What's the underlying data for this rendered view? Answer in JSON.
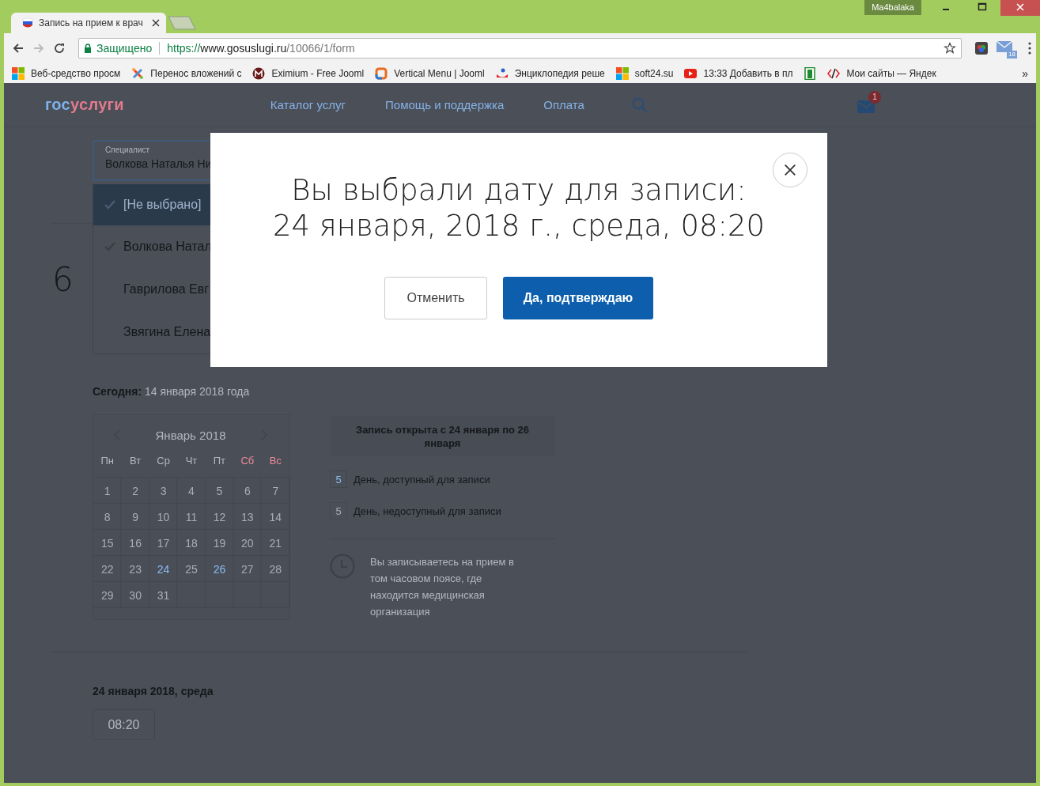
{
  "browser": {
    "profile": "Ma4balaka",
    "tabs": [
      {
        "title": "Запись на прием к врач",
        "selected": true
      }
    ],
    "address": {
      "security": "Защищено",
      "scheme": "https://",
      "host": "www.gosuslugi.ru",
      "path": "/10066/1/form"
    },
    "mail_badge": "18",
    "bookmarks": [
      {
        "kind": "windows",
        "label": "Веб-средство просм"
      },
      {
        "kind": "joomla",
        "label": "Перенос вложений с"
      },
      {
        "kind": "eximium",
        "label": "Eximium - Free Jooml"
      },
      {
        "kind": "ring",
        "label": "Vertical Menu | Jooml"
      },
      {
        "kind": "people",
        "label": "Энциклопедия реше"
      },
      {
        "kind": "windows",
        "label": "soft24.su"
      },
      {
        "kind": "youtube",
        "label": "13:33 Добавить в пл"
      },
      {
        "kind": "door"
      },
      {
        "kind": "code",
        "label": "Мои сайты — Яндек"
      }
    ],
    "more": "»"
  },
  "site": {
    "logo": {
      "first": "гос",
      "second": "услуги"
    },
    "nav": [
      "Каталог услуг",
      "Помощь и поддержка",
      "Оплата"
    ],
    "mail_badge": "1"
  },
  "specialist": {
    "label": "Специалист",
    "value": "Волкова Наталья Ни",
    "options": [
      {
        "label": "[Не выбрано]",
        "selected": true,
        "checked": true
      },
      {
        "label": "Волкова Натал",
        "selected": false,
        "checked": true
      },
      {
        "label": "Гаврилова Евг",
        "selected": false,
        "checked": false
      },
      {
        "label": "Звягина Елена",
        "selected": false,
        "checked": false
      }
    ]
  },
  "step": "6",
  "today": {
    "label": "Сегодня:",
    "value": "14 января 2018 года"
  },
  "calendar": {
    "month": "Январь 2018",
    "weekdays": [
      {
        "label": "Пн",
        "weekend": false
      },
      {
        "label": "Вт",
        "weekend": false
      },
      {
        "label": "Ср",
        "weekend": false
      },
      {
        "label": "Чт",
        "weekend": false
      },
      {
        "label": "Пт",
        "weekend": false
      },
      {
        "label": "Сб",
        "weekend": true
      },
      {
        "label": "Вс",
        "weekend": true
      }
    ],
    "days": [
      {
        "label": "1",
        "available": false
      },
      {
        "label": "2",
        "available": false
      },
      {
        "label": "3",
        "available": false
      },
      {
        "label": "4",
        "available": false
      },
      {
        "label": "5",
        "available": false
      },
      {
        "label": "6",
        "available": false
      },
      {
        "label": "7",
        "available": false
      },
      {
        "label": "8",
        "available": false
      },
      {
        "label": "9",
        "available": false
      },
      {
        "label": "10",
        "available": false
      },
      {
        "label": "11",
        "available": false
      },
      {
        "label": "12",
        "available": false
      },
      {
        "label": "13",
        "available": false
      },
      {
        "label": "14",
        "available": false
      },
      {
        "label": "15",
        "available": false
      },
      {
        "label": "16",
        "available": false
      },
      {
        "label": "17",
        "available": false
      },
      {
        "label": "18",
        "available": false
      },
      {
        "label": "19",
        "available": false
      },
      {
        "label": "20",
        "available": false
      },
      {
        "label": "21",
        "available": false
      },
      {
        "label": "22",
        "available": false
      },
      {
        "label": "23",
        "available": false
      },
      {
        "label": "24",
        "available": true
      },
      {
        "label": "25",
        "available": false
      },
      {
        "label": "26",
        "available": true
      },
      {
        "label": "27",
        "available": false
      },
      {
        "label": "28",
        "available": false
      },
      {
        "label": "29",
        "available": false
      },
      {
        "label": "30",
        "available": false
      },
      {
        "label": "31",
        "available": false
      }
    ]
  },
  "info": {
    "period": "Запись открыта с 24 января по 26 января",
    "legend": [
      {
        "sample": "5",
        "label": "День, доступный для записи",
        "available": true
      },
      {
        "sample": "5",
        "label": "День, недоступный для записи",
        "available": false
      }
    ],
    "timezone_note": "Вы записываетесь на прием в том часовом поясе, где находится медицинская организация"
  },
  "selected_date": {
    "title": "24 января 2018, среда",
    "slots": [
      "08:20"
    ]
  },
  "modal": {
    "line1": "Вы выбрали дату для записи:",
    "line2": "24 января, 2018 г., среда, 08:20",
    "cancel": "Отменить",
    "confirm": "Да, подтверждаю"
  }
}
